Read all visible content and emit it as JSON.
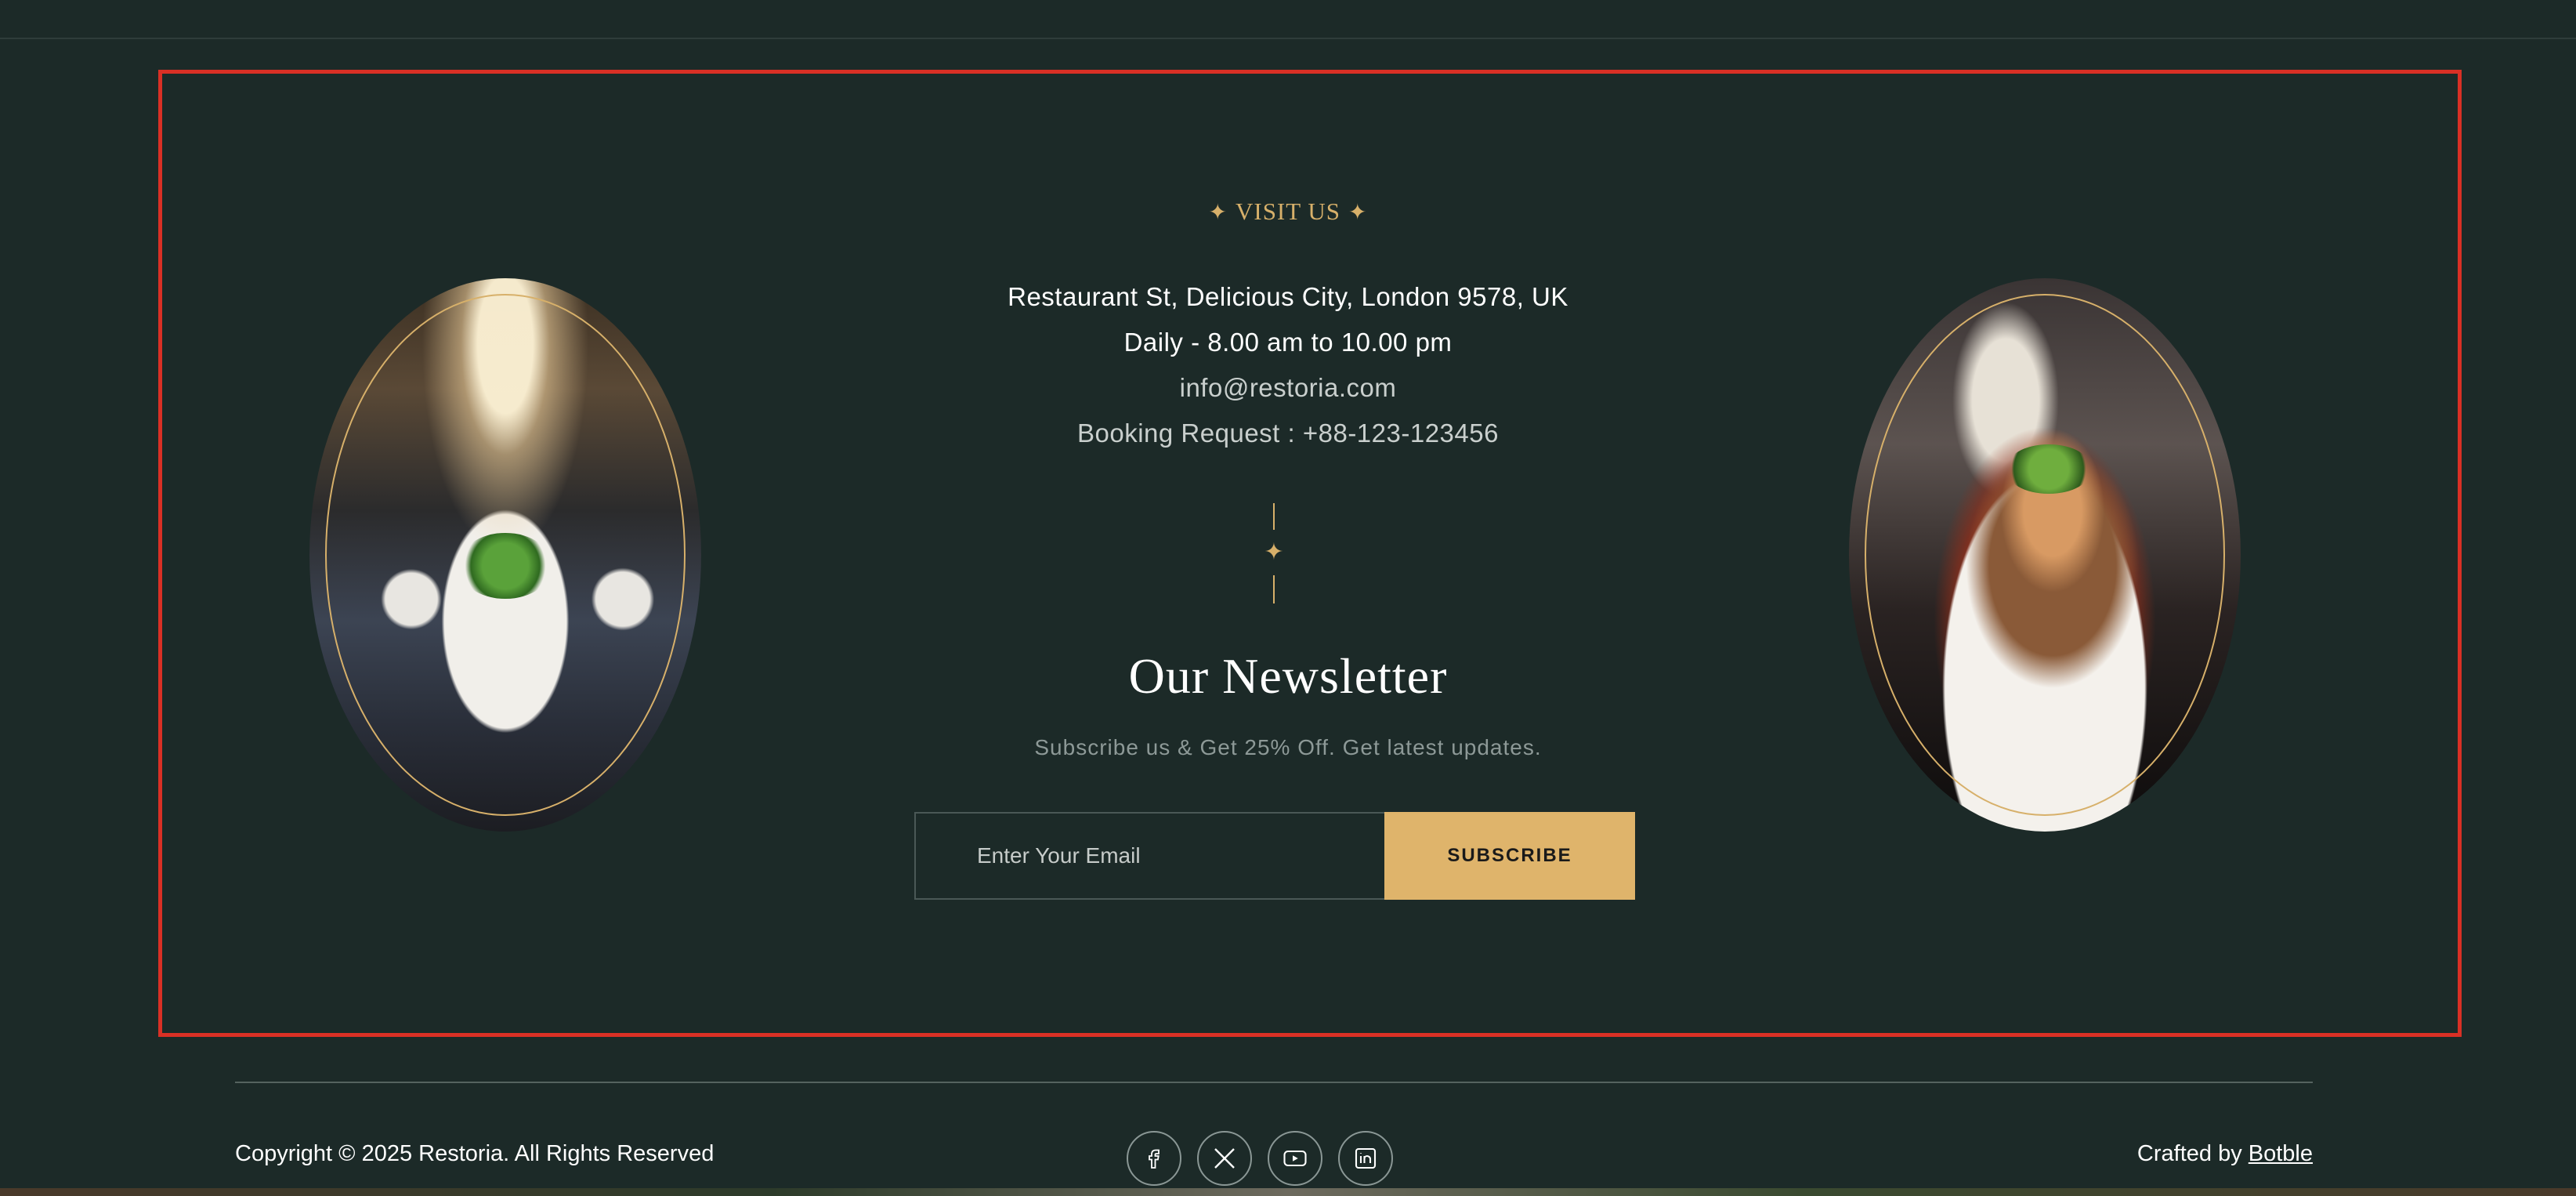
{
  "visit": {
    "eyebrow": "VISIT US",
    "address": "Restaurant St, Delicious City, London 9578, UK",
    "hours": "Daily - 8.00 am to 10.00 pm",
    "email": "info@restoria.com",
    "booking": "Booking Request : +88-123-123456"
  },
  "newsletter": {
    "title": "Our Newsletter",
    "subtitle": "Subscribe us & Get 25% Off. Get latest updates.",
    "email_placeholder": "Enter Your Email",
    "button_label": "SUBSCRIBE"
  },
  "footer": {
    "copyright": "Copyright © 2025 Restoria. All Rights Reserved",
    "crafted_by_prefix": "Crafted by ",
    "crafted_by_link": "Botble",
    "social": [
      "facebook-icon",
      "x-icon",
      "youtube-icon",
      "linkedin-icon"
    ]
  },
  "colors": {
    "background": "#1c2a28",
    "accent_gold": "#dfb46b",
    "highlight_frame": "#d93025"
  }
}
